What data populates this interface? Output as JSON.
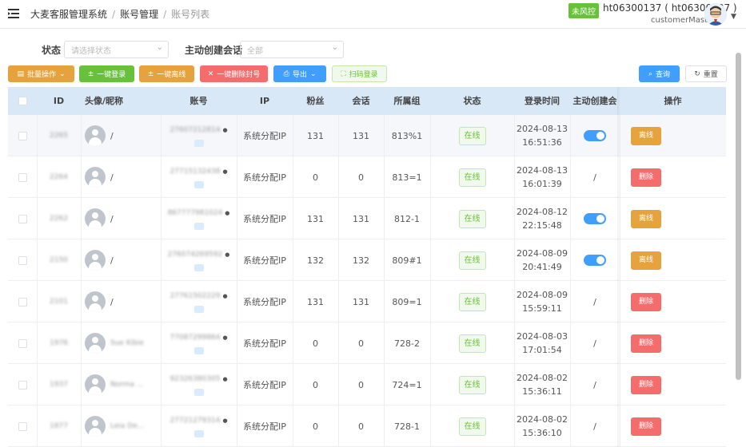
{
  "header": {
    "breadcrumb": [
      "大麦客服管理系统",
      "账号管理",
      "账号列表"
    ],
    "status_pill": "未风控",
    "user_name": "ht06300137 ( ht06300137 )",
    "user_role": "customerMaster"
  },
  "filters": {
    "status_label": "状态",
    "status_placeholder": "请选择状态",
    "session_label": "主动创建会话",
    "session_value": "全部"
  },
  "toolbar": {
    "batch": "批量操作",
    "login_all": "一键登录",
    "offline_all": "一键离线",
    "remove_banned": "一键删除封号",
    "export": "导出",
    "scan_login": "扫码登录",
    "query": "查询",
    "reset": "重置"
  },
  "columns": [
    "ID",
    "头像/昵称",
    "账号",
    "IP",
    "粉丝",
    "会话",
    "所属组",
    "状态",
    "登录时间",
    "主动创建会",
    "操作"
  ],
  "rows": [
    {
      "id": "2265",
      "nick": "/",
      "account": "2760721281​4",
      "ip": "系统分配IP",
      "fans": "131",
      "sessions": "131",
      "group": "813%1",
      "status": "在线",
      "login_date": "2024-08-13",
      "login_time": "16:51:36",
      "toggle": true,
      "action": "离线",
      "action_type": "warn"
    },
    {
      "id": "2264",
      "nick": "/",
      "account": "2771513243​8",
      "ip": "系统分配IP",
      "fans": "0",
      "sessions": "0",
      "group": "813=1",
      "status": "在线",
      "login_date": "2024-08-13",
      "login_time": "16:01:39",
      "toggle": false,
      "toggle_text": "/",
      "action": "删除",
      "action_type": "danger"
    },
    {
      "id": "2262",
      "nick": "/",
      "account": "8677779810​24",
      "ip": "系统分配IP",
      "fans": "131",
      "sessions": "131",
      "group": "812-1",
      "status": "在线",
      "login_date": "2024-08-12",
      "login_time": "22:15:48",
      "toggle": true,
      "action": "离线",
      "action_type": "warn"
    },
    {
      "id": "2150",
      "nick": "/",
      "account": "2760742695​92",
      "ip": "系统分配IP",
      "fans": "132",
      "sessions": "132",
      "group": "809#1",
      "status": "在线",
      "login_date": "2024-08-09",
      "login_time": "20:41:49",
      "toggle": true,
      "action": "离线",
      "action_type": "warn"
    },
    {
      "id": "2101",
      "nick": "/",
      "account": "2776150222​9",
      "ip": "系统分配IP",
      "fans": "131",
      "sessions": "131",
      "group": "809=1",
      "status": "在线",
      "login_date": "2024-08-09",
      "login_time": "15:59:11",
      "toggle": false,
      "toggle_text": "/",
      "action": "删除",
      "action_type": "danger"
    },
    {
      "id": "1976",
      "nick": "Sue Kibie",
      "account": "7708729986​4",
      "ip": "系统分配IP",
      "fans": "0",
      "sessions": "0",
      "group": "728-2",
      "status": "在线",
      "login_date": "2024-08-03",
      "login_time": "17:01:54",
      "toggle": false,
      "toggle_text": "/",
      "action": "删除",
      "action_type": "danger"
    },
    {
      "id": "1937",
      "nick": "Norma ...",
      "account": "9232638030​5",
      "ip": "系统分配IP",
      "fans": "0",
      "sessions": "0",
      "group": "724=1",
      "status": "在线",
      "login_date": "2024-08-02",
      "login_time": "15:36:11",
      "toggle": false,
      "toggle_text": "/",
      "action": "删除",
      "action_type": "danger"
    },
    {
      "id": "1877",
      "nick": "Leia De...",
      "account": "2772127931​4",
      "ip": "系统分配IP",
      "fans": "0",
      "sessions": "0",
      "group": "728-1",
      "status": "在线",
      "login_date": "2024-08-02",
      "login_time": "15:36:10",
      "toggle": false,
      "toggle_text": "/",
      "action": "删除",
      "action_type": "danger"
    }
  ],
  "colors": {
    "warn": "#e6a23c",
    "danger": "#f56c6c",
    "primary": "#409eff",
    "success": "#67c23a"
  }
}
